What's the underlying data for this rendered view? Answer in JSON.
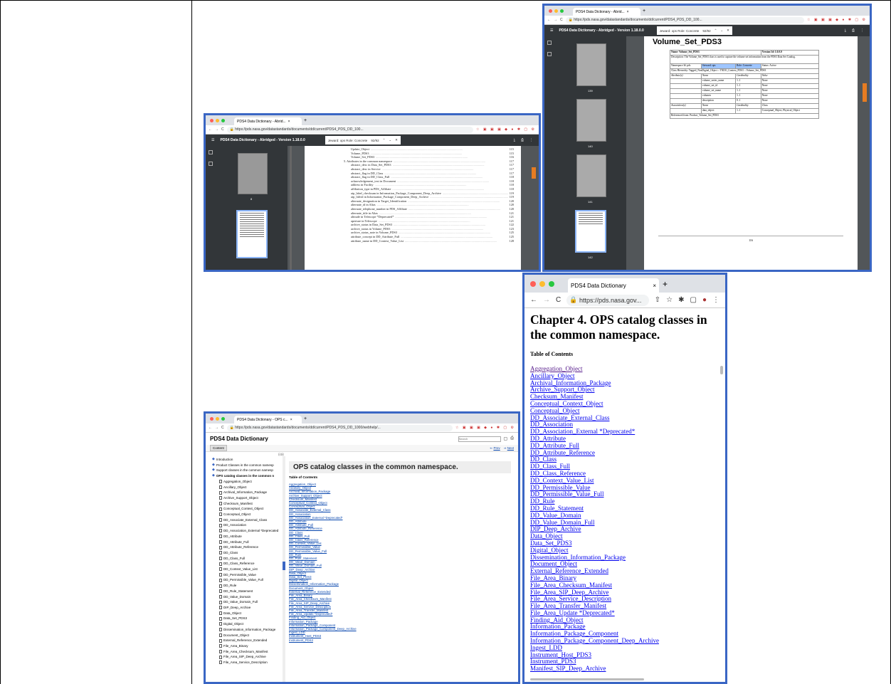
{
  "window_a": {
    "tab_title": "PDS4 Data Dictionary - Abrid...",
    "url": "https://pds.nasa.gov/datastandards/documents/dd/current/PDS4_PDS_DD_100...",
    "pdf_title": "PDS4 Data Dictionary - Abridged - Version 1.18.0.0",
    "find_query": "Jeward: ops Role: Concrete",
    "find_count": "92/92",
    "thumb_label": "8",
    "toc_lines": [
      {
        "text": "Update_Object",
        "page": "115"
      },
      {
        "text": "Volume_PDS3",
        "page": "115"
      },
      {
        "text": "Volume_Set_PDS3",
        "page": "116"
      },
      {
        "text": "5. Attributes in the common namespace",
        "page": "117"
      },
      {
        "text": "abstract_desc in Data_Set_PDS3",
        "page": "117"
      },
      {
        "text": "abstract_desc in Service",
        "page": "117"
      },
      {
        "text": "abstract_flag in DD_Class",
        "page": "117"
      },
      {
        "text": "abstract_flag in DD_Class_Full",
        "page": "118"
      },
      {
        "text": "acknowledgement_text in Document",
        "page": "118"
      },
      {
        "text": "address in Facility",
        "page": "118"
      },
      {
        "text": "affiliation_type in PDS_Affiliate",
        "page": "118"
      },
      {
        "text": "aip_label_checksum in Information_Package_Component_Deep_Archive",
        "page": "119"
      },
      {
        "text": "aip_lidvid in Information_Package_Component_Deep_Archive",
        "page": "119"
      },
      {
        "text": "alternate_designation in Target_Identification",
        "page": "120"
      },
      {
        "text": "alternate_id in Alias",
        "page": "120"
      },
      {
        "text": "alternate_telephone_number in PDS_Affiliate",
        "page": "120"
      },
      {
        "text": "alternate_title in Alias",
        "page": "121"
      },
      {
        "text": "altitude in Telescope *Deprecated*",
        "page": "121"
      },
      {
        "text": "aperture in Telescope",
        "page": "121"
      },
      {
        "text": "archive_status in Data_Set_PDS3",
        "page": "122"
      },
      {
        "text": "archive_status in Volume_PDS3",
        "page": "123"
      },
      {
        "text": "archive_status_note in Volume_PDS3",
        "page": "125"
      },
      {
        "text": "attribute_concept in DD_Attribute_Full",
        "page": "125"
      },
      {
        "text": "attribute_name in DD_Context_Value_List",
        "page": "128"
      }
    ]
  },
  "window_b": {
    "tab_title": "PDS4 Data Dictionary - Abrid...",
    "url": "https://pds.nasa.gov/datastandards/documents/dd/current/PDS4_PDS_DD_100...",
    "pdf_title": "PDS4 Data Dictionary - Abridged - Version 1.18.0.0",
    "find_query": "Jeward: ops Role: Concrete",
    "find_count": "92/92",
    "thumb_labels": [
      "139",
      "140",
      "141",
      "142"
    ],
    "heading": "Volume_Set_PDS3",
    "page_number": "116",
    "table": {
      "name": "Name: Volume_Set_PDS3",
      "version": "Version Id: 1.0.0.0",
      "description": "Description: The Volume_Set_PDS3 class is used to capture the volume set information from the PDS3 Data Set Catalog.",
      "namespace": "Namespace Id: pds",
      "steward": "Steward: ops",
      "role": "Role: Concrete",
      "status": "Status: Active",
      "hierarchy": "Class Hierarchy: Tagged_NonDigital_Object :: TNDO_Context_PDS3 :: Volume_Set_PDS3",
      "attr_header": [
        "Attribute(s)",
        "Name",
        "Cardinality",
        "Value"
      ],
      "attrs": [
        [
          "volume_series_name",
          "1..1",
          "None"
        ],
        [
          "volume_set_id",
          "1..1",
          "None"
        ],
        [
          "volume_set_name",
          "1..1",
          "None"
        ],
        [
          "volumes",
          "1..1",
          "None"
        ],
        [
          "description",
          "0..1",
          "None"
        ]
      ],
      "assoc_header": [
        "Association(s)",
        "Name",
        "Cardinality",
        "Class"
      ],
      "assoc": [
        "data_object",
        "1..1",
        "Conceptual_Object, Physical_Object"
      ],
      "referenced": "Referenced from: Product_Volume_Set_PDS3"
    }
  },
  "window_c": {
    "tab_title": "PDS4 Data Dictionary - OPS c...",
    "url": "https://pds.nasa.gov/datastandards/documents/dd/current/PDS4_PDS_DD_1000/webhelp/...",
    "site_title": "PDS4 Data Dictionary",
    "search_placeholder": "Search",
    "content_tab": "Content",
    "prev": "Prev",
    "next": "Next",
    "page_heading": "OPS catalog classes in the common namespace.",
    "toc_label": "Table of Contents",
    "nav_top": [
      "Introduction",
      "Product Classes in the common namesp",
      "Support classes in the common namesp",
      "OPS catalog classes in the common n"
    ],
    "nav_items": [
      "Aggregation_Object",
      "Ancillary_Object",
      "Archival_Information_Package",
      "Archive_Support_Object",
      "Checksum_Manifest",
      "Conceptual_Context_Object",
      "Conceptual_Object",
      "DD_Associate_External_Class",
      "DD_Association",
      "DD_Association_External *Deprecated",
      "DD_Attribute",
      "DD_Attribute_Full",
      "DD_Attribute_Reference",
      "DD_Class",
      "DD_Class_Full",
      "DD_Class_Reference",
      "DD_Context_Value_List",
      "DD_Permissible_Value",
      "DD_Permissible_Value_Full",
      "DD_Rule",
      "DD_Rule_Statement",
      "DD_Value_Domain",
      "DD_Value_Domain_Full",
      "DIP_Deep_Archive",
      "Data_Object",
      "Data_Set_PDS3",
      "Digital_Object",
      "Dissemination_Information_Package",
      "Document_Object",
      "External_Reference_Extended",
      "File_Area_Binary",
      "File_Area_Checksum_Manifest",
      "File_Area_SIP_Deep_Archive",
      "File_Area_Service_Description"
    ],
    "links": [
      "Aggregation_Object",
      "Ancillary_Object",
      "Archival_Information_Package",
      "Archive_Support_Object",
      "Checksum_Manifest",
      "Conceptual_Context_Object",
      "Conceptual_Object",
      "DD_Associate_External_Class",
      "DD_Association",
      "DD_Association_External *Deprecated*",
      "DD_Attribute",
      "DD_Attribute_Full",
      "DD_Attribute_Reference",
      "DD_Class",
      "DD_Class_Full",
      "DD_Class_Reference",
      "DD_Context_Value_List",
      "DD_Permissible_Value",
      "DD_Permissible_Value_Full",
      "DD_Rule",
      "DD_Rule_Statement",
      "DD_Value_Domain",
      "DD_Value_Domain_Full",
      "DIP_Deep_Archive",
      "Data_Object",
      "Data_Set_PDS3",
      "Digital_Object",
      "Dissemination_Information_Package",
      "Document_Object",
      "External_Reference_Extended",
      "File_Area_Binary",
      "File_Area_Checksum_Manifest",
      "File_Area_SIP_Deep_Archive",
      "File_Area_Service_Description",
      "File_Area_Transfer_Manifest",
      "File_Area_Update *Deprecated*",
      "Finding_Aid_Object",
      "Information_Package",
      "Information_Package_Component",
      "Information_Package_Component_Deep_Archive",
      "Ingest_LDD",
      "Instrument_Host_PDS3",
      "Instrument_PDS3"
    ]
  },
  "window_d": {
    "tab_title": "PDS4 Data Dictionary",
    "url": "https://pds.nasa.gov...",
    "heading": "Chapter 4. OPS catalog classes in the common namespace.",
    "toc_label": "Table of Contents",
    "links": [
      "Aggregation_Object",
      "Ancillary_Object",
      "Archival_Information_Package",
      "Archive_Support_Object",
      "Checksum_Manifest",
      "Conceptual_Context_Object",
      "Conceptual_Object",
      "DD_Associate_External_Class",
      "DD_Association",
      "DD_Association_External *Deprecated*",
      "DD_Attribute",
      "DD_Attribute_Full",
      "DD_Attribute_Reference",
      "DD_Class",
      "DD_Class_Full",
      "DD_Class_Reference",
      "DD_Context_Value_List",
      "DD_Permissible_Value",
      "DD_Permissible_Value_Full",
      "DD_Rule",
      "DD_Rule_Statement",
      "DD_Value_Domain",
      "DD_Value_Domain_Full",
      "DIP_Deep_Archive",
      "Data_Object",
      "Data_Set_PDS3",
      "Digital_Object",
      "Dissemination_Information_Package",
      "Document_Object",
      "External_Reference_Extended",
      "File_Area_Binary",
      "File_Area_Checksum_Manifest",
      "File_Area_SIP_Deep_Archive",
      "File_Area_Service_Description",
      "File_Area_Transfer_Manifest",
      "File_Area_Update *Deprecated*",
      "Finding_Aid_Object",
      "Information_Package",
      "Information_Package_Component",
      "Information_Package_Component_Deep_Archive",
      "Ingest_LDD",
      "Instrument_Host_PDS3",
      "Instrument_PDS3",
      "Manifest_SIP_Deep_Archive"
    ]
  },
  "colors": {
    "frame": "#3a66c4",
    "visited_link": "#551a8b",
    "link": "#0000ee"
  }
}
